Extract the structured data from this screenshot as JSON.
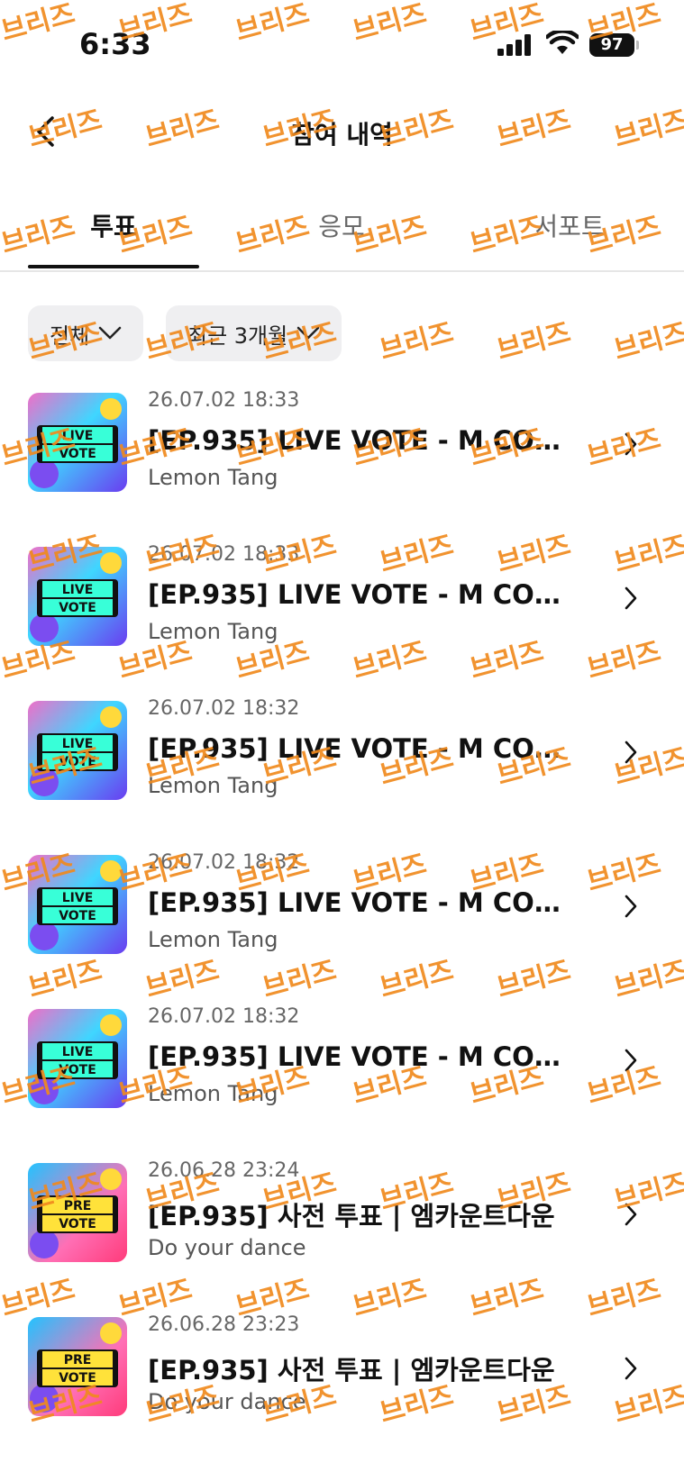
{
  "status": {
    "time": "6:33",
    "battery": "97"
  },
  "header": {
    "title": "참여 내역"
  },
  "tabs": [
    {
      "label": "투표"
    },
    {
      "label": "응모"
    },
    {
      "label": "서포트"
    }
  ],
  "filters": {
    "type": "전체",
    "period": "최근 3개월"
  },
  "watermark": "브리즈",
  "items": [
    {
      "date": "26.07.02 18:33",
      "title": "[EP.935] LIVE VOTE - M COUN...",
      "subtitle": "Lemon Tang",
      "badge_top": "LIVE",
      "badge_bottom": "VOTE"
    },
    {
      "date": "26.07.02 18:33",
      "title": "[EP.935] LIVE VOTE - M COUN...",
      "subtitle": "Lemon Tang",
      "badge_top": "LIVE",
      "badge_bottom": "VOTE"
    },
    {
      "date": "26.07.02 18:32",
      "title": "[EP.935] LIVE VOTE - M COUN...",
      "subtitle": "Lemon Tang",
      "badge_top": "LIVE",
      "badge_bottom": "VOTE"
    },
    {
      "date": "26.07.02 18:32",
      "title": "[EP.935] LIVE VOTE - M COUN...",
      "subtitle": "Lemon Tang",
      "badge_top": "LIVE",
      "badge_bottom": "VOTE"
    },
    {
      "date": "26.07.02 18:32",
      "title": "[EP.935] LIVE VOTE - M COUN...",
      "subtitle": "Lemon Tang",
      "badge_top": "LIVE",
      "badge_bottom": "VOTE"
    },
    {
      "date": "26.06.28 23:24",
      "title": "[EP.935] 사전 투표 | 엠카운트다운",
      "subtitle": "Do your dance",
      "badge_top": "PRE",
      "badge_bottom": "VOTE"
    },
    {
      "date": "26.06.28 23:23",
      "title": "[EP.935] 사전 투표 | 엠카운트다운",
      "subtitle": "Do your dance",
      "badge_top": "PRE",
      "badge_bottom": "VOTE"
    }
  ]
}
